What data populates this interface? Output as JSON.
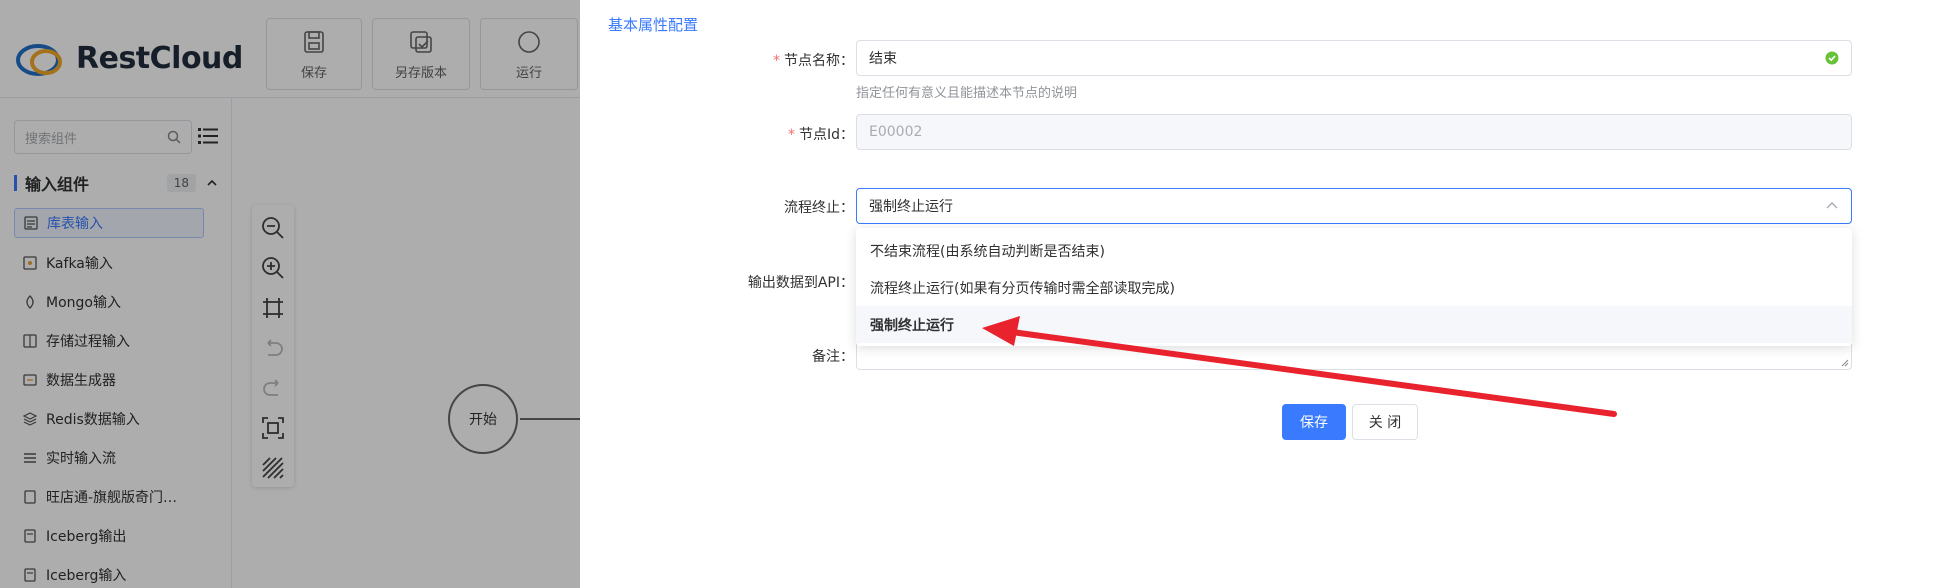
{
  "app": {
    "brand": "RestCloud",
    "toolbar": [
      {
        "label": "保存",
        "icon": "save-icon"
      },
      {
        "label": "另存版本",
        "icon": "save-version-icon"
      },
      {
        "label": "运行",
        "icon": "run-icon"
      }
    ],
    "search_placeholder": "搜索组件",
    "group": {
      "title": "输入组件",
      "count": "18"
    },
    "side_items": [
      {
        "label": "库表输入",
        "icon": "table-input-icon"
      },
      {
        "label": "Kafka输入",
        "icon": "kafka-icon"
      },
      {
        "label": "Mongo输入",
        "icon": "mongo-icon"
      },
      {
        "label": "存储过程输入",
        "icon": "procedure-icon"
      },
      {
        "label": "数据生成器",
        "icon": "generator-icon"
      },
      {
        "label": "Redis数据输入",
        "icon": "redis-icon"
      },
      {
        "label": "实时输入流",
        "icon": "stream-icon"
      },
      {
        "label": "旺店通-旗舰版奇门…",
        "icon": "shop-icon"
      },
      {
        "label": "Iceberg输出",
        "icon": "iceberg-icon"
      },
      {
        "label": "Iceberg输入",
        "icon": "iceberg-icon"
      }
    ],
    "start_node": "开始"
  },
  "drawer": {
    "section_title": "基本属性配置",
    "node_name": {
      "label": "节点名称：",
      "value": "结束",
      "hint": "指定任何有意义且能描述本节点的说明"
    },
    "node_id": {
      "label": "节点Id：",
      "value": "E00002"
    },
    "flow_end": {
      "label": "流程终止：",
      "value": "强制终止运行"
    },
    "output_api_label": "输出数据到API：",
    "remark_label": "备注：",
    "options": [
      {
        "label": "不结束流程(由系统自动判断是否结束)"
      },
      {
        "label": "流程终止运行(如果有分页传输时需全部读取完成)"
      },
      {
        "label": "强制终止运行"
      }
    ],
    "save_label": "保存",
    "close_label": "关 闭"
  },
  "colors": {
    "accent": "#3a7afe",
    "required": "#f56c6c",
    "valid": "#67c23a",
    "annotation": "#e8232e"
  }
}
